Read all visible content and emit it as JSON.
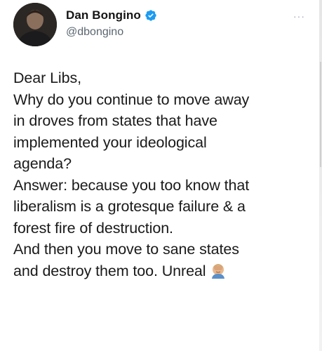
{
  "author": {
    "display_name": "Dan Bongino",
    "handle": "@dbongino",
    "verified": true,
    "avatar_icon": "profile-photo"
  },
  "menu": {
    "more_icon": "ellipsis-icon",
    "more_glyph": "···"
  },
  "tweet": {
    "lines": [
      "Dear Libs,",
      "Why do you continue to move away",
      "in droves from states that have",
      "implemented your ideological",
      "agenda?",
      "Answer: because you too know that",
      "liberalism is a grotesque failure & a",
      "forest fire of destruction.",
      "And then you move to sane states",
      "and destroy them too. Unreal"
    ],
    "trailing_emoji": "man-facepalming-emoji"
  },
  "colors": {
    "verified_blue": "#1d9bf0",
    "handle_gray": "#5b6670",
    "text": "#1a1a1a"
  }
}
